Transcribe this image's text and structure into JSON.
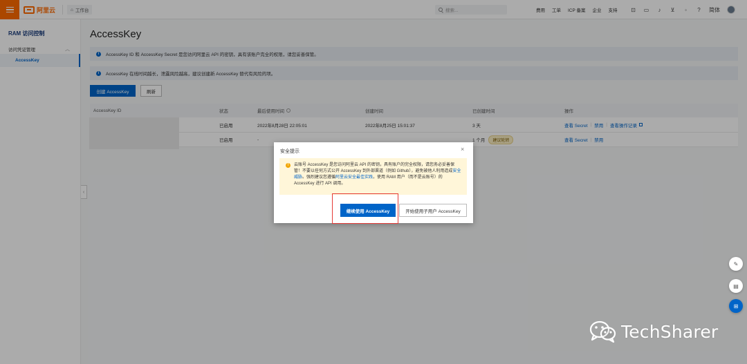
{
  "topbar": {
    "logo_text": "阿里云",
    "workbench_label": "工作台",
    "search_placeholder": "搜索...",
    "nav_links": [
      "费用",
      "工单",
      "ICP 备案",
      "企业",
      "支持"
    ],
    "language_label": "简体"
  },
  "sidebar": {
    "title": "RAM 访问控制",
    "group_label": "访问凭证管理",
    "active_item": "AccessKey"
  },
  "main": {
    "page_title": "AccessKey",
    "notice_1": "AccessKey ID 和 AccessKey Secret 是您访问阿里云 API 的密钥，具有该账户完全的权限，请您妥善保管。",
    "notice_2": "AccessKey 在线时间越长，泄露风险越高，建议创建新 AccessKey 替代有风险的项。",
    "create_button": "创建 AccessKey",
    "refresh_button": "刷新",
    "table": {
      "headers": [
        "AccessKey ID",
        "状态",
        "最后使用时间",
        "创建时间",
        "已创建时间",
        "操作"
      ],
      "rows": [
        {
          "id": "",
          "status": "已启用",
          "last_used": "2022年8月28日 22:05:01",
          "created": "2022年8月25日 15:01:37",
          "age": "3 天",
          "badge": "",
          "action_view": "查看 Secret",
          "action_disable": "禁用",
          "action_log": "查看操作记录"
        },
        {
          "id": "",
          "status": "已启用",
          "last_used": "-",
          "created": "",
          "age": "1 个月",
          "badge": "建议轮转",
          "action_view": "查看 Secret",
          "action_disable": "禁用",
          "action_log": ""
        }
      ]
    }
  },
  "dialog": {
    "title": "安全提示",
    "warning_part1": "云账号 AccessKey 是您访问阿里云 API 的密钥，具有账户的完全权限，请您务必妥善保管！不要以任何方式公开 AccessKey 到外部渠道（例如 Github），避免被他人利用造成",
    "warning_link1": "安全威胁",
    "warning_part2": "。强烈建议您遵循",
    "warning_link2": "阿里云安全最佳实践",
    "warning_part3": "，使用 RAM 用户（而不是云账号）的 AccessKey 进行 API 调用。",
    "continue_button": "继续使用 AccessKey",
    "subuser_button": "开始使用子用户 AccessKey"
  },
  "watermark": {
    "text": "TechSharer"
  },
  "colors": {
    "brand_orange": "#ff6a00",
    "primary_blue": "#0064c8",
    "warning_bg": "#fff6d9",
    "highlight_red": "#e53935"
  }
}
